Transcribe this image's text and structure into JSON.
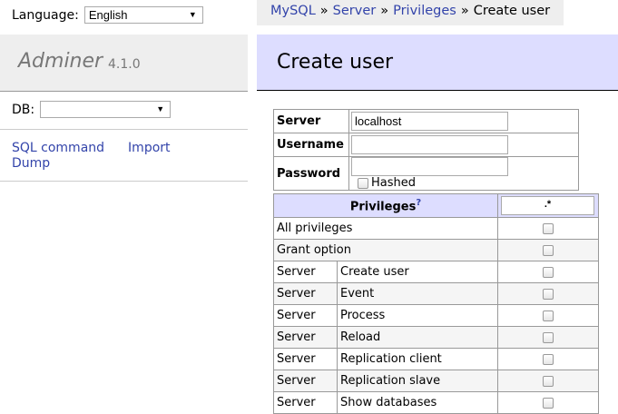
{
  "menu": {
    "language_label": "Language:",
    "language_value": "English",
    "app_name": "Adminer",
    "version": "4.1.0",
    "db_label": "DB:",
    "db_value": "",
    "links": {
      "sql_command": "SQL command",
      "import": "Import",
      "dump": "Dump"
    }
  },
  "breadcrumb": {
    "items": [
      "MySQL",
      "Server",
      "Privileges"
    ],
    "separator": "»",
    "current": "Create user"
  },
  "page": {
    "title": "Create user"
  },
  "form": {
    "server_label": "Server",
    "server_value": "localhost",
    "username_label": "Username",
    "username_value": "",
    "password_label": "Password",
    "password_value": "",
    "hashed_label": "Hashed"
  },
  "privileges": {
    "header": "Privileges",
    "help_mark": "?",
    "object_value": ".*",
    "rows": [
      {
        "group": "All privileges",
        "name": ""
      },
      {
        "group": "Grant option",
        "name": ""
      },
      {
        "group": "Server",
        "name": "Create user"
      },
      {
        "group": "Server",
        "name": "Event"
      },
      {
        "group": "Server",
        "name": "Process"
      },
      {
        "group": "Server",
        "name": "Reload"
      },
      {
        "group": "Server",
        "name": "Replication client"
      },
      {
        "group": "Server",
        "name": "Replication slave"
      },
      {
        "group": "Server",
        "name": "Show databases"
      }
    ]
  },
  "colors": {
    "link": "#3344aa",
    "header_bg": "#ddddff",
    "menu_bg": "#eeeeee"
  },
  "icons": {
    "dropdown": "chevron-down-icon"
  }
}
